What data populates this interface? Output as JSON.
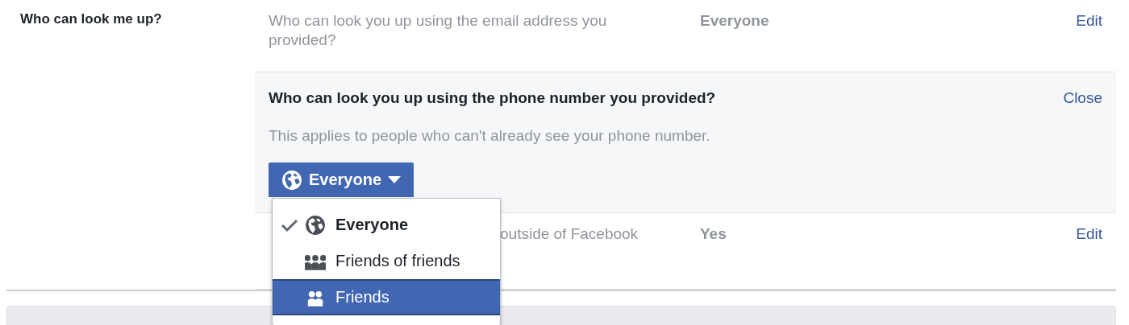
{
  "section_label": "Who can look me up?",
  "rows": [
    {
      "kind": "collapsed",
      "description": "Who can look you up using the email address you provided?",
      "value": "Everyone",
      "action": "Edit"
    },
    {
      "kind": "expanded",
      "title": "Who can look you up using the phone number you provided?",
      "action": "Close",
      "description": "This applies to people who can't already see your phone number.",
      "audience_button": "Everyone"
    },
    {
      "kind": "covered",
      "description": "outside of Facebook",
      "value": "Yes",
      "action": "Edit"
    }
  ],
  "menu": [
    {
      "label": "Everyone",
      "kind": "globe",
      "checked": true,
      "selected": false
    },
    {
      "label": "Friends of friends",
      "kind": "group",
      "checked": false,
      "selected": false
    },
    {
      "label": "Friends",
      "kind": "pair",
      "checked": false,
      "selected": true
    }
  ]
}
